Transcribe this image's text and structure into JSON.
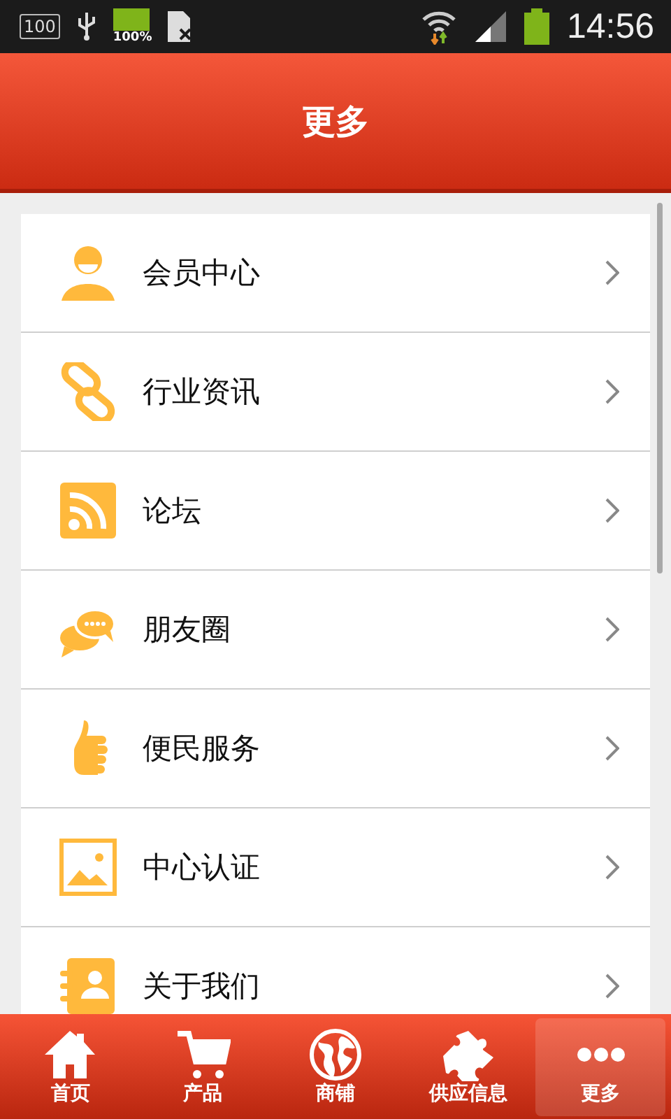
{
  "status_bar": {
    "badge": "100",
    "battery_text": "100%",
    "time": "14:56"
  },
  "header": {
    "title": "更多"
  },
  "menu": [
    {
      "label": "会员中心",
      "kind": "person"
    },
    {
      "label": "行业资讯",
      "kind": "link"
    },
    {
      "label": "论坛",
      "kind": "rss"
    },
    {
      "label": "朋友圈",
      "kind": "chat"
    },
    {
      "label": "便民服务",
      "kind": "thumb"
    },
    {
      "label": "中心认证",
      "kind": "image"
    },
    {
      "label": "关于我们",
      "kind": "contact"
    }
  ],
  "tabs": [
    {
      "label": "首页",
      "kind": "home",
      "selected": false
    },
    {
      "label": "产品",
      "kind": "cart",
      "selected": false
    },
    {
      "label": "商铺",
      "kind": "globe",
      "selected": false
    },
    {
      "label": "供应信息",
      "kind": "puzzle",
      "selected": false
    },
    {
      "label": "更多",
      "kind": "dots",
      "selected": true
    }
  ]
}
